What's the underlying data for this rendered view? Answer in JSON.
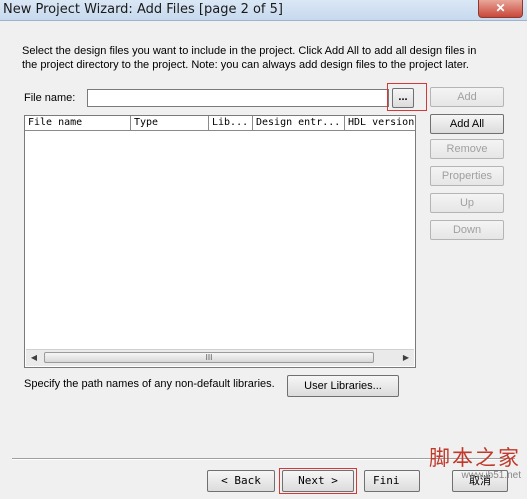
{
  "window": {
    "title": "New Project Wizard: Add Files [page 2 of 5]",
    "close_icon": "close-icon"
  },
  "intro": {
    "text": "Select the design files you want to include in the project. Click Add All to add all design files in the project directory to the project. Note: you can always add design files to the project later."
  },
  "file_name": {
    "label": "File name:",
    "value": "",
    "browse_label": "..."
  },
  "side_buttons": {
    "add": "Add",
    "add_all": "Add All",
    "remove": "Remove",
    "properties": "Properties",
    "up": "Up",
    "down": "Down"
  },
  "table": {
    "columns": [
      "File name",
      "Type",
      "Lib...",
      "Design entr...",
      "HDL version"
    ],
    "rows": [],
    "scroll_thumb_grip": "III"
  },
  "libraries": {
    "text": "Specify the path names of any non-default libraries.",
    "button": "User Libraries..."
  },
  "footer": {
    "back": "< Back",
    "next": "Next >",
    "finish": "Fini",
    "cancel": "取消"
  },
  "watermark": {
    "line1": "脚本之家",
    "line2": "www.jb51.net"
  }
}
